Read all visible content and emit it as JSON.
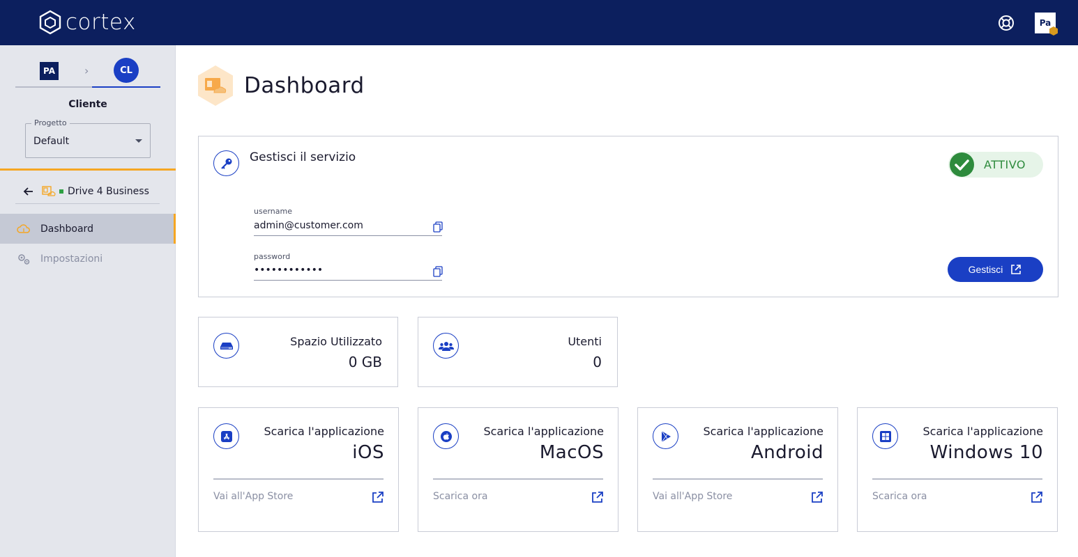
{
  "app": {
    "name": "cortex"
  },
  "topbar": {
    "user_badge": "Pa"
  },
  "sidebar": {
    "breadcrumb": {
      "from": "PA",
      "to": "CL"
    },
    "client_label": "Cliente",
    "project": {
      "legend": "Progetto",
      "value": "Default"
    },
    "product": {
      "name": "Drive 4 Business"
    },
    "nav": [
      {
        "label": "Dashboard",
        "icon": "cloud-icon",
        "active": true
      },
      {
        "label": "Impostazioni",
        "icon": "gears-icon",
        "active": false
      }
    ]
  },
  "page": {
    "title": "Dashboard"
  },
  "service": {
    "title": "Gestisci il servizio",
    "status": "ATTIVO",
    "username_label": "username",
    "username_value": "admin@customer.com",
    "password_label": "password",
    "password_value": "••••••••••••",
    "manage_button": "Gestisci"
  },
  "stats": [
    {
      "label": "Spazio Utilizzato",
      "value": "0 GB",
      "icon": "storage-icon"
    },
    {
      "label": "Utenti",
      "value": "0",
      "icon": "users-icon"
    }
  ],
  "apps": [
    {
      "caption": "Scarica l'applicazione",
      "name": "iOS",
      "link": "Vai all'App Store",
      "icon": "app-store-icon"
    },
    {
      "caption": "Scarica l'applicazione",
      "name": "MacOS",
      "link": "Scarica ora",
      "icon": "apple-icon"
    },
    {
      "caption": "Scarica l'applicazione",
      "name": "Android",
      "link": "Vai all'App Store",
      "icon": "play-store-icon"
    },
    {
      "caption": "Scarica l'applicazione",
      "name": "Windows 10",
      "link": "Scarica ora",
      "icon": "windows-icon"
    }
  ],
  "colors": {
    "topbar": "#0c1f5e",
    "accent": "#1a3fc4",
    "highlight": "#f5a623",
    "success": "#2e8b3d"
  }
}
